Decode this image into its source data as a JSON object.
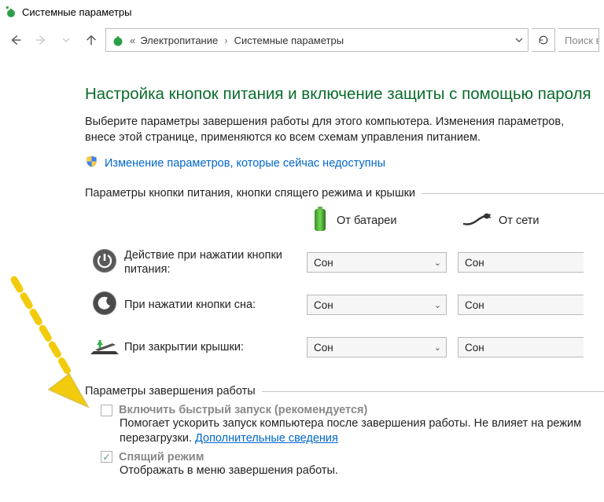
{
  "window": {
    "title": "Системные параметры"
  },
  "address": {
    "crumb1": "Электропитание",
    "crumb2": "Системные параметры"
  },
  "search": {
    "placeholder": "Поиск в"
  },
  "heading": "Настройка кнопок питания и включение защиты с помощью пароля",
  "intro": "Выберите параметры завершения работы для этого компьютера. Изменения параметров, внесе этой странице, применяются ко всем схемам управления питанием.",
  "admin_link": "Изменение параметров, которые сейчас недоступны",
  "panel_buttons": {
    "legend": "Параметры кнопки питания, кнопки спящего режима и крышки",
    "col_battery": "От батареи",
    "col_plugged": "От сети",
    "rows": [
      {
        "label": "Действие при нажатии кнопки питания:",
        "battery": "Сон",
        "plugged": "Сон"
      },
      {
        "label": "При нажатии кнопки сна:",
        "battery": "Сон",
        "plugged": "Сон"
      },
      {
        "label": "При закрытии крышки:",
        "battery": "Сон",
        "plugged": "Сон"
      }
    ]
  },
  "panel_shutdown": {
    "legend": "Параметры завершения работы",
    "opts": [
      {
        "checked": false,
        "title": "Включить быстрый запуск (рекомендуется)",
        "desc_pre": "Помогает ускорить запуск компьютера после завершения работы. Не влияет на режим перезагрузки. ",
        "link": "Дополнительные сведения"
      },
      {
        "checked": true,
        "title": "Спящий режим",
        "desc_pre": "Отображать в меню завершения работы.",
        "link": ""
      }
    ]
  }
}
